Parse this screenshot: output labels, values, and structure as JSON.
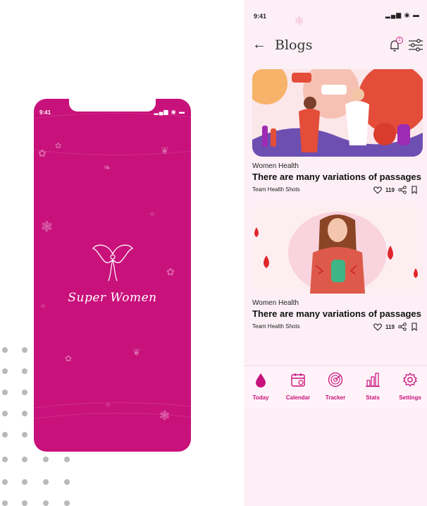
{
  "splash": {
    "status_time": "9:41",
    "status_icons": "▂▄▆ ◉ ▬",
    "brand_name": "Super Women",
    "colors": {
      "background": "#c8117b"
    }
  },
  "blogs_screen": {
    "status_time": "9:41",
    "status_icons": "▂▄▆ ◉ ▬",
    "header": {
      "back_icon": "arrow-left-icon",
      "title": "Blogs",
      "notification_icon": "bell-icon",
      "notification_count": "1",
      "filter_icon": "sliders-icon"
    },
    "posts": [
      {
        "category": "Women Health",
        "title": "There are many variations of passages",
        "author": "Team Health Shots",
        "likes": "119",
        "image": "doctor-consultation-illustration"
      },
      {
        "category": "Women Health",
        "title": "There are many variations of passages",
        "author": "Team Health Shots",
        "likes": "119",
        "image": "period-cramps-illustration"
      }
    ],
    "bottom_nav": [
      {
        "label": "Today",
        "icon": "drop-icon"
      },
      {
        "label": "Calendar",
        "icon": "calendar-icon"
      },
      {
        "label": "Tracker",
        "icon": "radar-icon"
      },
      {
        "label": "Stats",
        "icon": "bar-chart-icon"
      },
      {
        "label": "Settings",
        "icon": "gear-icon"
      }
    ],
    "colors": {
      "accent": "#c8117b",
      "background": "#fcf0f6"
    }
  }
}
